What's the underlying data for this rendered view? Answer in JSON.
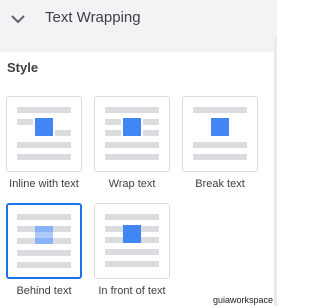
{
  "header": {
    "title": "Text Wrapping",
    "icon": "chevron-down-icon"
  },
  "section": {
    "title": "Style"
  },
  "options": [
    {
      "label": "Inline with text",
      "selected": false
    },
    {
      "label": "Wrap text",
      "selected": false
    },
    {
      "label": "Break text",
      "selected": false
    },
    {
      "label": "Behind text",
      "selected": true
    },
    {
      "label": "In front of text",
      "selected": false
    }
  ],
  "watermark": "guiaworkspace",
  "colors": {
    "accent": "#1a73e8",
    "image": "#4285f4",
    "line": "#dadce0",
    "header_bg": "#f1f3f4"
  }
}
